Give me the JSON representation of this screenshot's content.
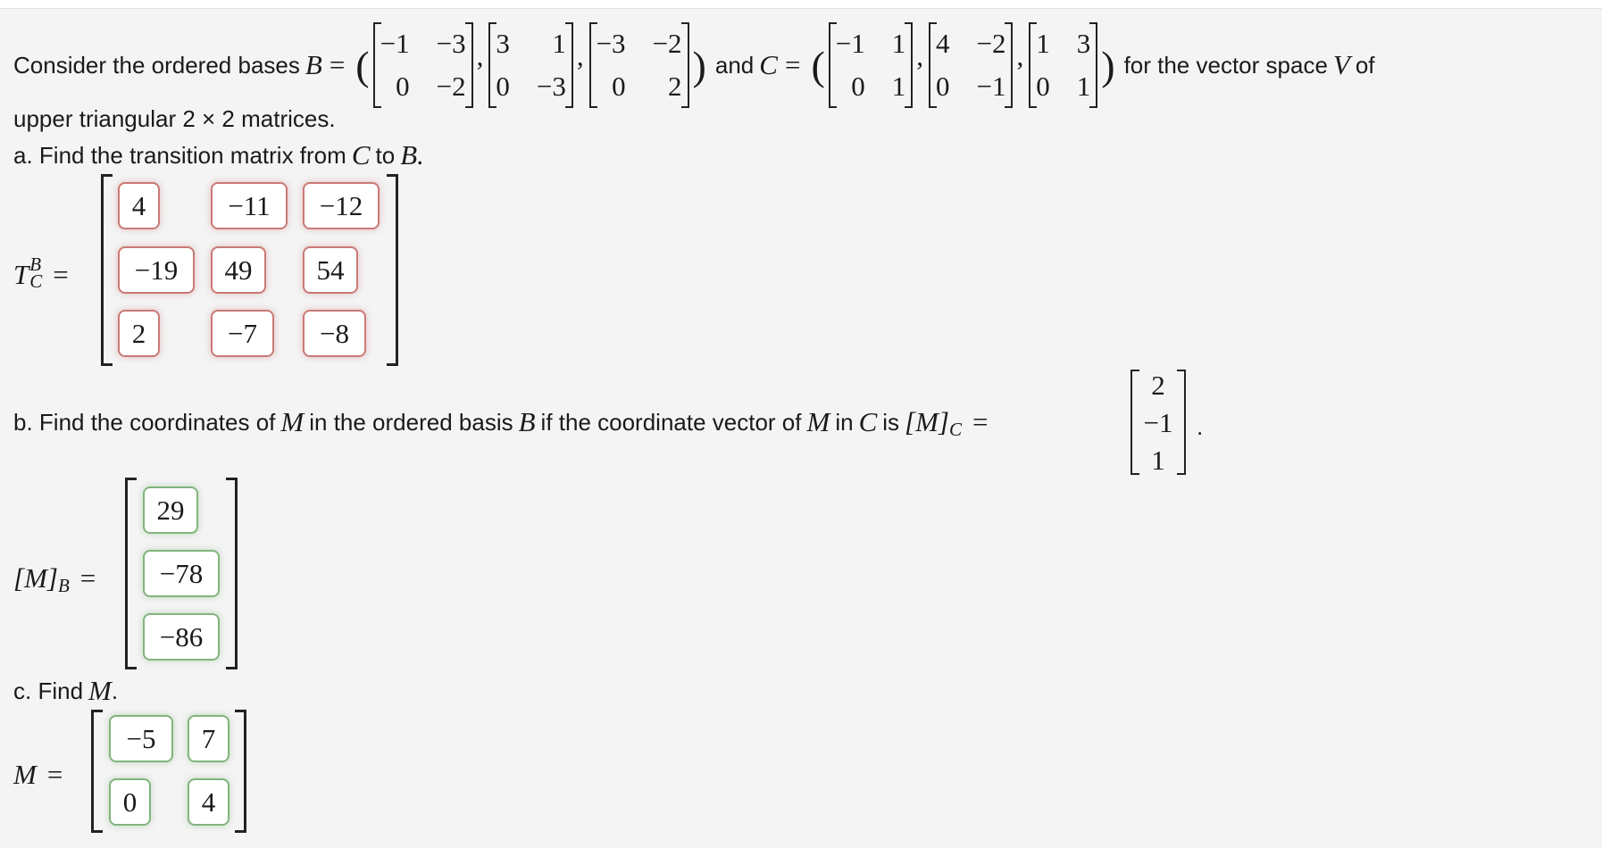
{
  "intro": {
    "prefix": "Consider the ordered bases",
    "B_symbol": "B",
    "equals": "=",
    "open_paren": "(",
    "close_paren": ")",
    "and": "and",
    "C_symbol": "C",
    "suffix": "for the vector space",
    "V_symbol": "V",
    "of": "of",
    "line2": "upper triangular 2 × 2 matrices.",
    "basis_B": [
      [
        [
          "−1",
          "−3"
        ],
        [
          "0",
          "−2"
        ]
      ],
      [
        [
          "3",
          "1"
        ],
        [
          "0",
          "−3"
        ]
      ],
      [
        [
          "−3",
          "−2"
        ],
        [
          "0",
          "2"
        ]
      ]
    ],
    "basis_C": [
      [
        [
          "−1",
          "1"
        ],
        [
          "0",
          "1"
        ]
      ],
      [
        [
          "4",
          "−2"
        ],
        [
          "0",
          "−1"
        ]
      ],
      [
        [
          "1",
          "3"
        ],
        [
          "0",
          "1"
        ]
      ]
    ],
    "comma": ","
  },
  "part_a": {
    "prompt_prefix": "a. Find the transition matrix from",
    "from": "C",
    "to_word": "to",
    "to": "B.",
    "label_T": "T",
    "label_sup": "B",
    "label_sub": "C",
    "equals": "=",
    "answers": [
      [
        "4",
        "−11",
        "−12"
      ],
      [
        "−19",
        "49",
        "54"
      ],
      [
        "2",
        "−7",
        "−8"
      ]
    ],
    "status": "incorrect",
    "status_color": "#c97a77"
  },
  "part_b": {
    "prompt_prefix": "b. Find the coordinates of",
    "M": "M",
    "mid1": "in the ordered basis",
    "B": "B",
    "mid2": "if the coordinate vector of",
    "mid3": "in",
    "C": "C",
    "is": "is",
    "lhs": "[M]",
    "lhs_sub": "C",
    "equals": "=",
    "given_vector": [
      "2",
      "−1",
      "1"
    ],
    "period": ".",
    "answer_label": "[M]",
    "answer_sub": "B",
    "answers": [
      "29",
      "−78",
      "−86"
    ],
    "status": "correct",
    "status_color": "#82b47e"
  },
  "part_c": {
    "prompt_prefix": "c. Find",
    "M": "M",
    "period": ".",
    "label": "M",
    "equals": "=",
    "answers": [
      [
        "−5",
        "7"
      ],
      [
        "0",
        "4"
      ]
    ],
    "status": "correct",
    "status_color": "#82b47e"
  }
}
